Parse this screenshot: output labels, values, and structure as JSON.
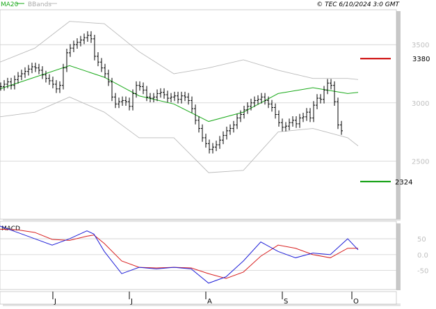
{
  "header": {
    "legend_ma": "MA20",
    "legend_bbands": "BBands",
    "copyright": "© TEC 6/10/2024 3:0 GMT"
  },
  "colors": {
    "ma": "#1aaa1a",
    "bbands": "#bbbbbb",
    "price": "#000000",
    "resistance": "#cc0000",
    "support": "#009900",
    "macd_line": "#1f1fd8",
    "signal_line": "#d81f1f",
    "grid": "#cfcfcf",
    "frame_shadow": "#c8c8c8"
  },
  "chart_data": [
    {
      "type": "ohlc",
      "title": "",
      "y_axis": {
        "side": "right",
        "ticks": [
          2500,
          3000,
          3500
        ],
        "ylim": [
          2000,
          3800
        ]
      },
      "x_axis": {
        "ticks": [
          "J",
          "J",
          "A",
          "S",
          "O"
        ],
        "tick_bars": [
          16,
          38,
          60,
          82,
          102
        ]
      },
      "levels": [
        {
          "name": "resistance",
          "label": "3380",
          "value": 3380
        },
        {
          "name": "support",
          "label": "2324",
          "value": 2324
        }
      ],
      "series": [
        {
          "name": "MA20",
          "x": [
            0,
            10,
            20,
            30,
            40,
            50,
            60,
            70,
            80,
            90,
            100,
            103
          ],
          "values": [
            3120,
            3220,
            3320,
            3220,
            3060,
            2990,
            2840,
            2920,
            3080,
            3130,
            3080,
            3090
          ]
        },
        {
          "name": "BBands upper",
          "x": [
            0,
            10,
            20,
            30,
            40,
            50,
            60,
            70,
            80,
            90,
            100,
            103
          ],
          "values": [
            3350,
            3470,
            3700,
            3680,
            3440,
            3250,
            3300,
            3370,
            3280,
            3210,
            3210,
            3200
          ]
        },
        {
          "name": "BBands lower",
          "x": [
            0,
            10,
            20,
            30,
            40,
            50,
            60,
            70,
            80,
            90,
            100,
            103
          ],
          "values": [
            2880,
            2920,
            3050,
            2920,
            2700,
            2700,
            2400,
            2420,
            2750,
            2780,
            2700,
            2630
          ]
        }
      ],
      "ohlc_close": [
        3140,
        3160,
        3180,
        3150,
        3200,
        3230,
        3250,
        3270,
        3290,
        3310,
        3300,
        3280,
        3240,
        3210,
        3190,
        3160,
        3120,
        3150,
        3300,
        3430,
        3470,
        3500,
        3520,
        3540,
        3560,
        3580,
        3550,
        3400,
        3350,
        3300,
        3250,
        3180,
        3050,
        2990,
        3010,
        3020,
        3010,
        2970,
        3080,
        3150,
        3140,
        3110,
        3050,
        3040,
        3050,
        3080,
        3090,
        3070,
        3040,
        3050,
        3060,
        3030,
        3060,
        3050,
        3020,
        2950,
        2850,
        2780,
        2700,
        2650,
        2600,
        2620,
        2640,
        2680,
        2720,
        2760,
        2780,
        2810,
        2870,
        2900,
        2940,
        2970,
        3000,
        3020,
        3030,
        3050,
        3020,
        2990,
        2960,
        2900,
        2830,
        2790,
        2800,
        2830,
        2850,
        2820,
        2870,
        2880,
        2920,
        2870,
        2980,
        3040,
        3030,
        3110,
        3170,
        3150,
        3010,
        2810,
        2760
      ]
    },
    {
      "type": "line",
      "title": "MACD",
      "y_axis": {
        "side": "right",
        "ticks": [
          50,
          0,
          -50
        ],
        "tick_labels": [
          "50",
          "0.0",
          "-50"
        ],
        "ylim": [
          -110,
          105
        ]
      },
      "series": [
        {
          "name": "MACD",
          "x": [
            0,
            5,
            10,
            15,
            20,
            25,
            27,
            30,
            35,
            40,
            45,
            50,
            55,
            60,
            65,
            70,
            75,
            80,
            85,
            90,
            95,
            100,
            103
          ],
          "values": [
            90,
            70,
            50,
            30,
            50,
            75,
            65,
            10,
            -60,
            -40,
            -45,
            -40,
            -45,
            -90,
            -70,
            -20,
            40,
            10,
            -10,
            5,
            0,
            50,
            15
          ]
        },
        {
          "name": "signal",
          "x": [
            0,
            5,
            10,
            15,
            20,
            25,
            27,
            30,
            35,
            40,
            45,
            50,
            55,
            60,
            65,
            70,
            75,
            80,
            85,
            90,
            95,
            100,
            103
          ],
          "values": [
            80,
            78,
            70,
            48,
            45,
            58,
            62,
            35,
            -20,
            -40,
            -42,
            -40,
            -42,
            -60,
            -75,
            -55,
            -5,
            30,
            20,
            0,
            -10,
            20,
            20
          ]
        }
      ]
    }
  ]
}
